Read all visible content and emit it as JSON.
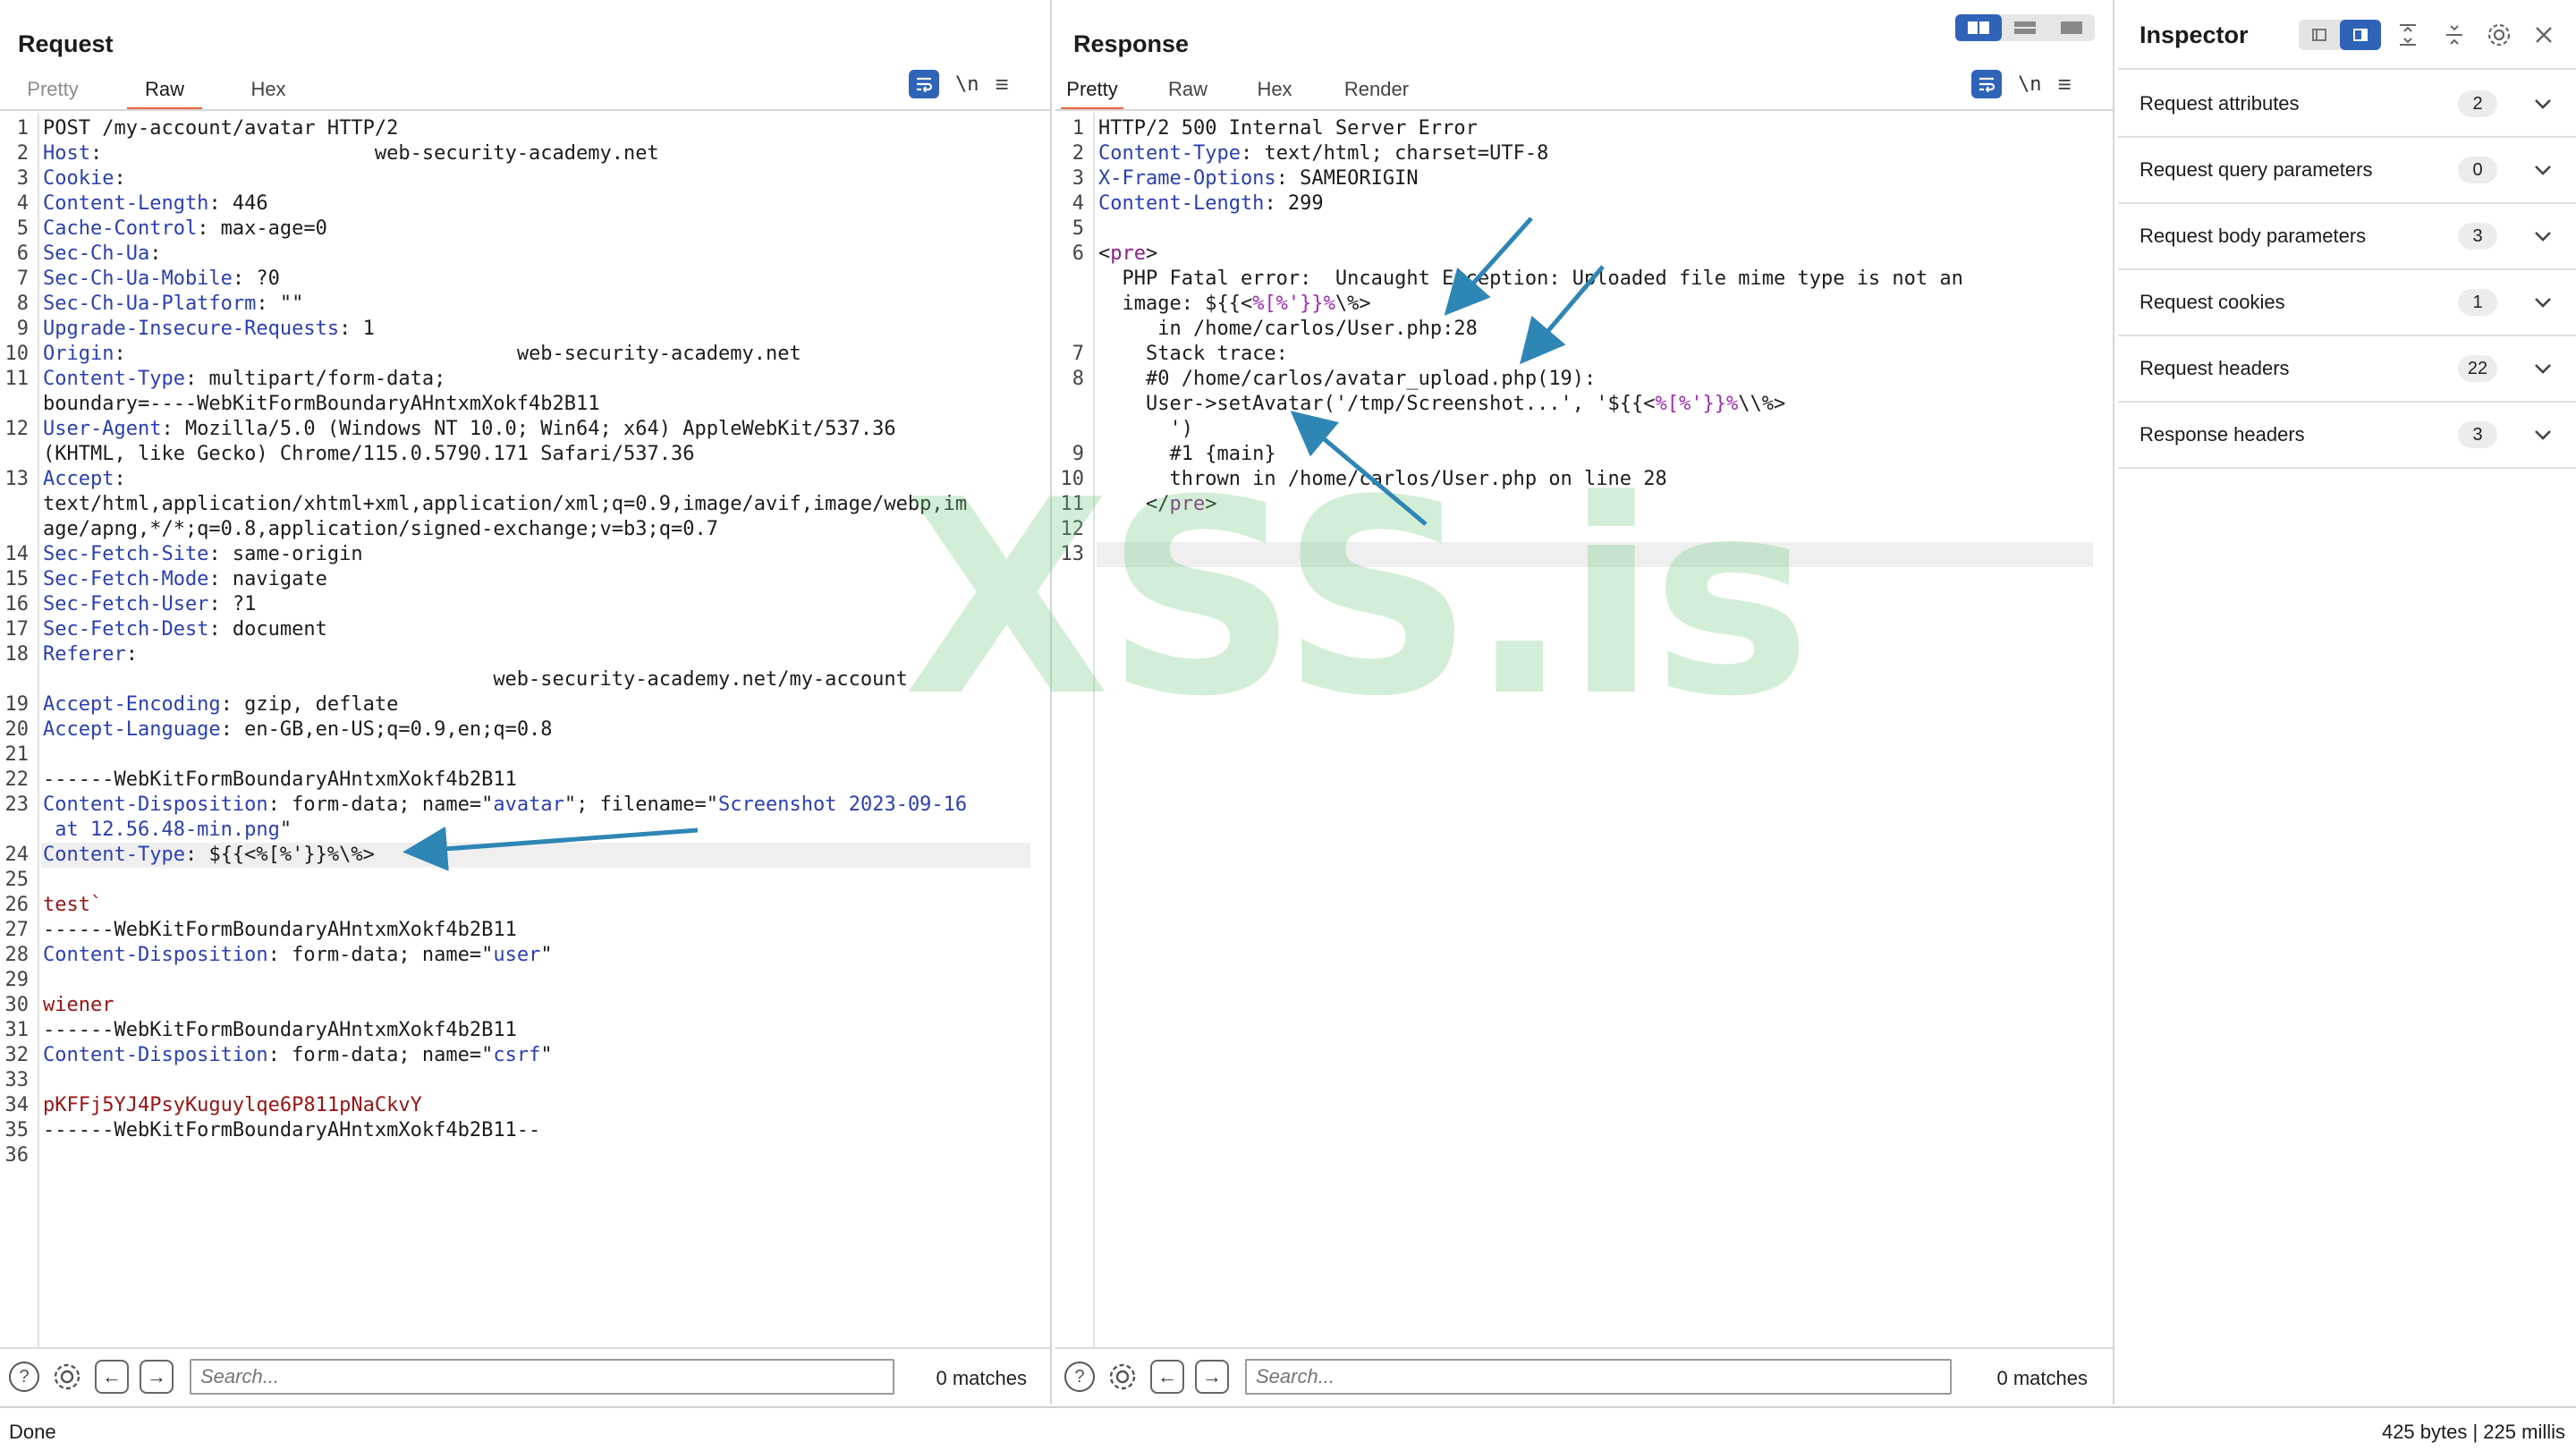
{
  "request": {
    "title": "Request",
    "tabs": [
      "Pretty",
      "Raw",
      "Hex"
    ],
    "active_tab": "Raw",
    "newline_toggle": "\\n",
    "lines": [
      [
        [
          "v",
          "POST /my-account/avatar HTTP/2"
        ]
      ],
      [
        [
          "k",
          "Host"
        ],
        [
          "v",
          ":                       web-security-academy.net"
        ]
      ],
      [
        [
          "k",
          "Cookie"
        ],
        [
          "v",
          ":"
        ]
      ],
      [
        [
          "k",
          "Content-Length"
        ],
        [
          "v",
          ": 446"
        ]
      ],
      [
        [
          "k",
          "Cache-Control"
        ],
        [
          "v",
          ": max-age=0"
        ]
      ],
      [
        [
          "k",
          "Sec-Ch-Ua"
        ],
        [
          "v",
          ":"
        ]
      ],
      [
        [
          "k",
          "Sec-Ch-Ua-Mobile"
        ],
        [
          "v",
          ": ?0"
        ]
      ],
      [
        [
          "k",
          "Sec-Ch-Ua-Platform"
        ],
        [
          "v",
          ": \"\""
        ]
      ],
      [
        [
          "k",
          "Upgrade-Insecure-Requests"
        ],
        [
          "v",
          ": 1"
        ]
      ],
      [
        [
          "k",
          "Origin"
        ],
        [
          "v",
          ":                                 web-security-academy.net"
        ]
      ],
      [
        [
          "k",
          "Content-Type"
        ],
        [
          "v",
          ": multipart/form-data;"
        ]
      ],
      [
        [
          "v",
          "boundary=----WebKitFormBoundaryAHntxmXokf4b2B11"
        ]
      ],
      [
        [
          "k",
          "User-Agent"
        ],
        [
          "v",
          ": Mozilla/5.0 (Windows NT 10.0; Win64; x64) AppleWebKit/537.36"
        ]
      ],
      [
        [
          "v",
          "(KHTML, like Gecko) Chrome/115.0.5790.171 Safari/537.36"
        ]
      ],
      [
        [
          "k",
          "Accept"
        ],
        [
          "v",
          ":"
        ]
      ],
      [
        [
          "v",
          "text/html,application/xhtml+xml,application/xml;q=0.9,image/avif,image/webp,im"
        ]
      ],
      [
        [
          "v",
          "age/apng,*/*;q=0.8,application/signed-exchange;v=b3;q=0.7"
        ]
      ],
      [
        [
          "k",
          "Sec-Fetch-Site"
        ],
        [
          "v",
          ": same-origin"
        ]
      ],
      [
        [
          "k",
          "Sec-Fetch-Mode"
        ],
        [
          "v",
          ": navigate"
        ]
      ],
      [
        [
          "k",
          "Sec-Fetch-User"
        ],
        [
          "v",
          ": ?1"
        ]
      ],
      [
        [
          "k",
          "Sec-Fetch-Dest"
        ],
        [
          "v",
          ": document"
        ]
      ],
      [
        [
          "k",
          "Referer"
        ],
        [
          "v",
          ":"
        ]
      ],
      [
        [
          "v",
          "                                      web-security-academy.net/my-account"
        ]
      ],
      [
        [
          "k",
          "Accept-Encoding"
        ],
        [
          "v",
          ": gzip, deflate"
        ]
      ],
      [
        [
          "k",
          "Accept-Language"
        ],
        [
          "v",
          ": en-GB,en-US;q=0.9,en;q=0.8"
        ]
      ],
      [],
      [
        [
          "v",
          "------WebKitFormBoundaryAHntxmXokf4b2B11"
        ]
      ],
      [
        [
          "k",
          "Content-Disposition"
        ],
        [
          "v",
          ": form-data; name=\""
        ],
        [
          "s",
          "avatar"
        ],
        [
          "v",
          "\"; filename=\""
        ],
        [
          "s",
          "Screenshot 2023-09-16"
        ]
      ],
      [
        [
          "s",
          " at 12.56.48-min.png"
        ],
        [
          "v",
          "\""
        ]
      ],
      [
        [
          "k",
          "Content-Type"
        ],
        [
          "v",
          ": ${{<%[%'}}%\\%>"
        ]
      ],
      [],
      [
        [
          "bod",
          "test`"
        ]
      ],
      [
        [
          "v",
          "------WebKitFormBoundaryAHntxmXokf4b2B11"
        ]
      ],
      [
        [
          "k",
          "Content-Disposition"
        ],
        [
          "v",
          ": form-data; name=\""
        ],
        [
          "s",
          "user"
        ],
        [
          "v",
          "\""
        ]
      ],
      [],
      [
        [
          "bod",
          "wiener"
        ]
      ],
      [
        [
          "v",
          "------WebKitFormBoundaryAHntxmXokf4b2B11"
        ]
      ],
      [
        [
          "k",
          "Content-Disposition"
        ],
        [
          "v",
          ": form-data; name=\""
        ],
        [
          "s",
          "csrf"
        ],
        [
          "v",
          "\""
        ]
      ],
      [],
      [
        [
          "bod",
          "pKFFj5YJ4PsyKuguylqe6P811pNaCkvY"
        ]
      ],
      [
        [
          "v",
          "------WebKitFormBoundaryAHntxmXokf4b2B11--"
        ]
      ],
      []
    ],
    "line_numbers": [
      "1",
      "2",
      "3",
      "4",
      "5",
      "6",
      "7",
      "8",
      "9",
      "10",
      "11",
      "",
      "12",
      "",
      "13",
      "",
      "",
      "14",
      "15",
      "16",
      "17",
      "18",
      "",
      "19",
      "20",
      "21",
      "22",
      "23",
      "",
      "24",
      "25",
      "26",
      "27",
      "28",
      "29",
      "30",
      "31",
      "32",
      "33",
      "34",
      "35",
      "36"
    ],
    "highlighted_line_index": 29,
    "search_placeholder": "Search...",
    "matches": "0 matches"
  },
  "response": {
    "title": "Response",
    "tabs": [
      "Pretty",
      "Raw",
      "Hex",
      "Render"
    ],
    "active_tab": "Pretty",
    "newline_toggle": "\\n",
    "lines": [
      [
        [
          "v",
          "HTTP/2 500 Internal Server Error"
        ]
      ],
      [
        [
          "k",
          "Content-Type"
        ],
        [
          "v",
          ": text/html; charset=UTF-8"
        ]
      ],
      [
        [
          "k",
          "X-Frame-Options"
        ],
        [
          "v",
          ": SAMEORIGIN"
        ]
      ],
      [
        [
          "k",
          "Content-Length"
        ],
        [
          "v",
          ": 299"
        ]
      ],
      [],
      [
        [
          "v",
          "<"
        ],
        [
          "tag",
          "pre"
        ],
        [
          "v",
          ">"
        ]
      ],
      [
        [
          "v",
          "  PHP Fatal error:  Uncaught Exception: Uploaded file mime type is not an"
        ]
      ],
      [
        [
          "v",
          "  image: ${{<"
        ],
        [
          "tmpl",
          "%[%'}}%"
        ],
        [
          "v",
          "\\%>"
        ]
      ],
      [
        [
          "v",
          "     in /home/carlos/User.php:28"
        ]
      ],
      [
        [
          "v",
          "    Stack trace:"
        ]
      ],
      [
        [
          "v",
          "    #0 /home/carlos/avatar_upload.php(19):"
        ]
      ],
      [
        [
          "v",
          "    User->setAvatar('/tmp/Screenshot...', '${{<"
        ],
        [
          "tmpl",
          "%[%'}}%"
        ],
        [
          "v",
          "\\\\%>"
        ]
      ],
      [
        [
          "v",
          "      ')"
        ]
      ],
      [
        [
          "v",
          "      #1 {main}"
        ]
      ],
      [
        [
          "v",
          "      thrown in /home/carlos/User.php on line 28"
        ]
      ],
      [
        [
          "v",
          "    </"
        ],
        [
          "tag",
          "pre"
        ],
        [
          "v",
          ">"
        ]
      ],
      [],
      []
    ],
    "line_numbers": [
      "1",
      "2",
      "3",
      "4",
      "5",
      "6",
      "",
      "",
      "",
      "7",
      "8",
      "",
      "",
      "9",
      "10",
      "11",
      "12",
      "13"
    ],
    "highlighted_line_index": 17,
    "search_placeholder": "Search...",
    "matches": "0 matches"
  },
  "inspector": {
    "title": "Inspector",
    "rows": [
      {
        "label": "Request attributes",
        "count": "2"
      },
      {
        "label": "Request query parameters",
        "count": "0"
      },
      {
        "label": "Request body parameters",
        "count": "3"
      },
      {
        "label": "Request cookies",
        "count": "1"
      },
      {
        "label": "Request headers",
        "count": "22"
      },
      {
        "label": "Response headers",
        "count": "3"
      }
    ]
  },
  "status": {
    "left": "Done",
    "right": "425 bytes | 225 millis"
  },
  "watermark": "XSS.is",
  "colors": {
    "accent_blue": "#2f63b8",
    "tab_underline": "#e8643a",
    "header_key": "#2a3fb3",
    "body_value": "#9a1212",
    "arrow": "#2e86b5",
    "watermark": "#6ec878"
  }
}
